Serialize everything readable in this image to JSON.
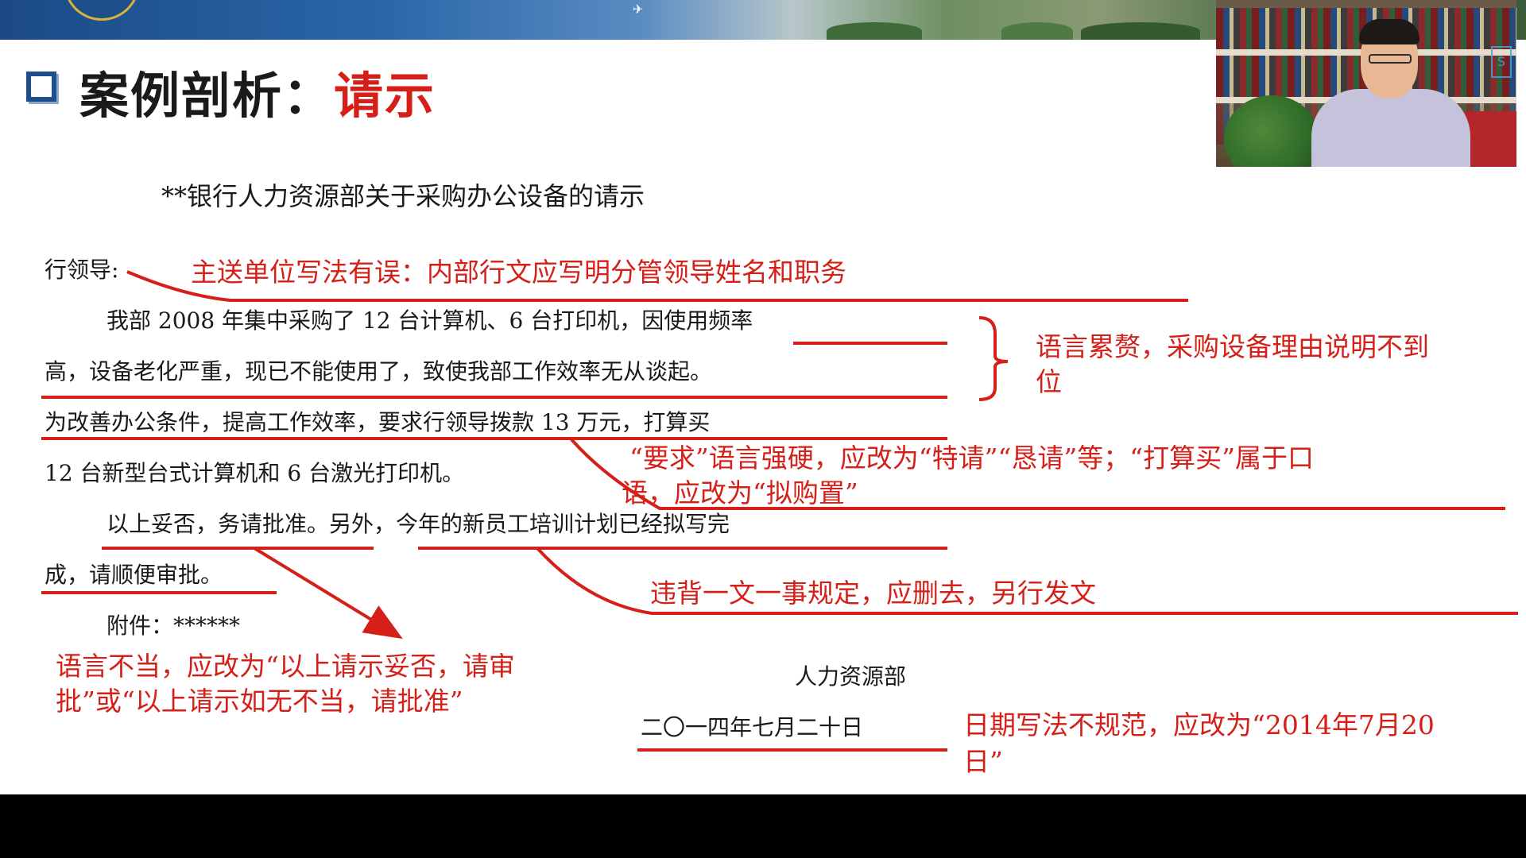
{
  "slide": {
    "title_prefix": "案例剖析：",
    "title_highlight": "请示"
  },
  "document": {
    "title": "**银行人力资源部关于采购办公设备的请示",
    "addressee": "行领导:",
    "body_lines": [
      "我部 2008 年集中采购了 12 台计算机、6 台打印机，因使用频率",
      "高，设备老化严重，现已不能使用了，致使我部工作效率无从谈起。",
      "为改善办公条件，提高工作效率，要求行领导拨款 13 万元，打算买",
      "12 台新型台式计算机和 6 台激光打印机。",
      "以上妥否，务请批准。另外，今年的新员工培训计划已经拟写完",
      "成，请顺便审批。"
    ],
    "attachment": "附件：******",
    "sender": "人力资源部",
    "date": "二〇一四年七月二十日"
  },
  "annotations": {
    "addressee_note": "主送单位写法有误：内部行文应写明分管领导姓名和职务",
    "reason_note_line1": "语言累赘，采购设备理由说明不到",
    "reason_note_line2": "位",
    "request_note_line1": "“要求”语言强硬，应改为“特请”“恳请”等；“打算买”属于口",
    "request_note_line2": "语，应改为“拟购置”",
    "one_matter_note": "违背一文一事规定，应删去，另行发文",
    "closing_note_line1": "语言不当，应改为“以上请示妥否，请审",
    "closing_note_line2": "批”或“以上请示如无不当，请批准”",
    "date_note_line1": "日期写法不规范，应改为“2014年7月20",
    "date_note_line2": "日”"
  },
  "colors": {
    "annotation_red": "#d42018",
    "title_blue": "#1f4e8f",
    "text_dark": "#1a1a1a"
  }
}
